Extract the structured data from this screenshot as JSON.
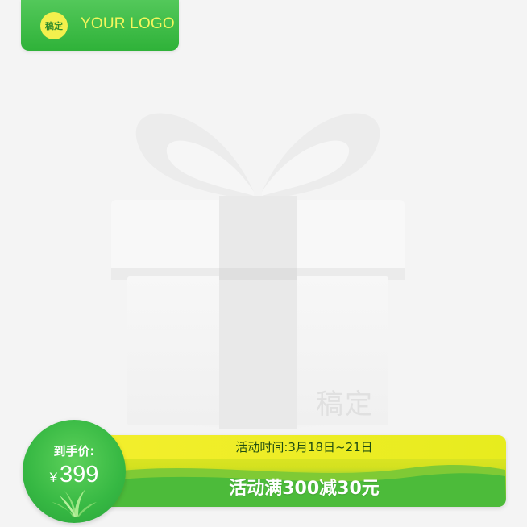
{
  "logo": {
    "badge_text": "稿定",
    "text": "YOUR LOGO"
  },
  "product": {
    "image": "gift-box",
    "watermark": "稿定"
  },
  "price": {
    "label": "到手价:",
    "currency": "¥",
    "value": "399"
  },
  "promo": {
    "time_text": "活动时间:3月18日~21日",
    "offer_text": "活动满300减30元"
  },
  "colors": {
    "primary_green": "#36b843",
    "accent_yellow": "#f3ee2c",
    "logo_text": "#f4f65d"
  }
}
